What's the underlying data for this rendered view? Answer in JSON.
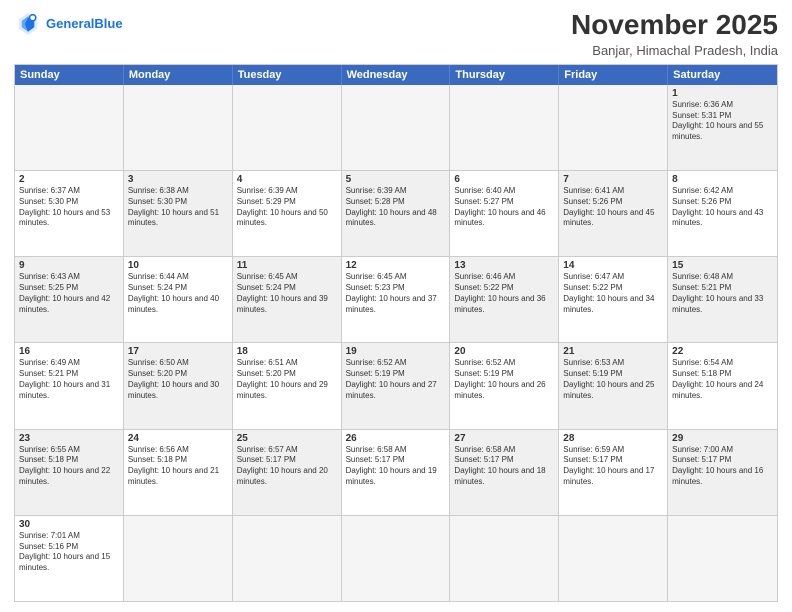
{
  "header": {
    "logo_general": "General",
    "logo_blue": "Blue",
    "title": "November 2025",
    "subtitle": "Banjar, Himachal Pradesh, India"
  },
  "weekdays": [
    "Sunday",
    "Monday",
    "Tuesday",
    "Wednesday",
    "Thursday",
    "Friday",
    "Saturday"
  ],
  "rows": [
    [
      {
        "day": "",
        "text": "",
        "empty": true
      },
      {
        "day": "",
        "text": "",
        "empty": true
      },
      {
        "day": "",
        "text": "",
        "empty": true
      },
      {
        "day": "",
        "text": "",
        "empty": true
      },
      {
        "day": "",
        "text": "",
        "empty": true
      },
      {
        "day": "",
        "text": "",
        "empty": true
      },
      {
        "day": "1",
        "text": "Sunrise: 6:36 AM\nSunset: 5:31 PM\nDaylight: 10 hours and 55 minutes.",
        "empty": false,
        "shaded": true
      }
    ],
    [
      {
        "day": "2",
        "text": "Sunrise: 6:37 AM\nSunset: 5:30 PM\nDaylight: 10 hours and 53 minutes.",
        "empty": false,
        "shaded": false
      },
      {
        "day": "3",
        "text": "Sunrise: 6:38 AM\nSunset: 5:30 PM\nDaylight: 10 hours and 51 minutes.",
        "empty": false,
        "shaded": true
      },
      {
        "day": "4",
        "text": "Sunrise: 6:39 AM\nSunset: 5:29 PM\nDaylight: 10 hours and 50 minutes.",
        "empty": false,
        "shaded": false
      },
      {
        "day": "5",
        "text": "Sunrise: 6:39 AM\nSunset: 5:28 PM\nDaylight: 10 hours and 48 minutes.",
        "empty": false,
        "shaded": true
      },
      {
        "day": "6",
        "text": "Sunrise: 6:40 AM\nSunset: 5:27 PM\nDaylight: 10 hours and 46 minutes.",
        "empty": false,
        "shaded": false
      },
      {
        "day": "7",
        "text": "Sunrise: 6:41 AM\nSunset: 5:26 PM\nDaylight: 10 hours and 45 minutes.",
        "empty": false,
        "shaded": true
      },
      {
        "day": "8",
        "text": "Sunrise: 6:42 AM\nSunset: 5:26 PM\nDaylight: 10 hours and 43 minutes.",
        "empty": false,
        "shaded": false
      }
    ],
    [
      {
        "day": "9",
        "text": "Sunrise: 6:43 AM\nSunset: 5:25 PM\nDaylight: 10 hours and 42 minutes.",
        "empty": false,
        "shaded": true
      },
      {
        "day": "10",
        "text": "Sunrise: 6:44 AM\nSunset: 5:24 PM\nDaylight: 10 hours and 40 minutes.",
        "empty": false,
        "shaded": false
      },
      {
        "day": "11",
        "text": "Sunrise: 6:45 AM\nSunset: 5:24 PM\nDaylight: 10 hours and 39 minutes.",
        "empty": false,
        "shaded": true
      },
      {
        "day": "12",
        "text": "Sunrise: 6:45 AM\nSunset: 5:23 PM\nDaylight: 10 hours and 37 minutes.",
        "empty": false,
        "shaded": false
      },
      {
        "day": "13",
        "text": "Sunrise: 6:46 AM\nSunset: 5:22 PM\nDaylight: 10 hours and 36 minutes.",
        "empty": false,
        "shaded": true
      },
      {
        "day": "14",
        "text": "Sunrise: 6:47 AM\nSunset: 5:22 PM\nDaylight: 10 hours and 34 minutes.",
        "empty": false,
        "shaded": false
      },
      {
        "day": "15",
        "text": "Sunrise: 6:48 AM\nSunset: 5:21 PM\nDaylight: 10 hours and 33 minutes.",
        "empty": false,
        "shaded": true
      }
    ],
    [
      {
        "day": "16",
        "text": "Sunrise: 6:49 AM\nSunset: 5:21 PM\nDaylight: 10 hours and 31 minutes.",
        "empty": false,
        "shaded": false
      },
      {
        "day": "17",
        "text": "Sunrise: 6:50 AM\nSunset: 5:20 PM\nDaylight: 10 hours and 30 minutes.",
        "empty": false,
        "shaded": true
      },
      {
        "day": "18",
        "text": "Sunrise: 6:51 AM\nSunset: 5:20 PM\nDaylight: 10 hours and 29 minutes.",
        "empty": false,
        "shaded": false
      },
      {
        "day": "19",
        "text": "Sunrise: 6:52 AM\nSunset: 5:19 PM\nDaylight: 10 hours and 27 minutes.",
        "empty": false,
        "shaded": true
      },
      {
        "day": "20",
        "text": "Sunrise: 6:52 AM\nSunset: 5:19 PM\nDaylight: 10 hours and 26 minutes.",
        "empty": false,
        "shaded": false
      },
      {
        "day": "21",
        "text": "Sunrise: 6:53 AM\nSunset: 5:19 PM\nDaylight: 10 hours and 25 minutes.",
        "empty": false,
        "shaded": true
      },
      {
        "day": "22",
        "text": "Sunrise: 6:54 AM\nSunset: 5:18 PM\nDaylight: 10 hours and 24 minutes.",
        "empty": false,
        "shaded": false
      }
    ],
    [
      {
        "day": "23",
        "text": "Sunrise: 6:55 AM\nSunset: 5:18 PM\nDaylight: 10 hours and 22 minutes.",
        "empty": false,
        "shaded": true
      },
      {
        "day": "24",
        "text": "Sunrise: 6:56 AM\nSunset: 5:18 PM\nDaylight: 10 hours and 21 minutes.",
        "empty": false,
        "shaded": false
      },
      {
        "day": "25",
        "text": "Sunrise: 6:57 AM\nSunset: 5:17 PM\nDaylight: 10 hours and 20 minutes.",
        "empty": false,
        "shaded": true
      },
      {
        "day": "26",
        "text": "Sunrise: 6:58 AM\nSunset: 5:17 PM\nDaylight: 10 hours and 19 minutes.",
        "empty": false,
        "shaded": false
      },
      {
        "day": "27",
        "text": "Sunrise: 6:58 AM\nSunset: 5:17 PM\nDaylight: 10 hours and 18 minutes.",
        "empty": false,
        "shaded": true
      },
      {
        "day": "28",
        "text": "Sunrise: 6:59 AM\nSunset: 5:17 PM\nDaylight: 10 hours and 17 minutes.",
        "empty": false,
        "shaded": false
      },
      {
        "day": "29",
        "text": "Sunrise: 7:00 AM\nSunset: 5:17 PM\nDaylight: 10 hours and 16 minutes.",
        "empty": false,
        "shaded": true
      }
    ],
    [
      {
        "day": "30",
        "text": "Sunrise: 7:01 AM\nSunset: 5:16 PM\nDaylight: 10 hours and 15 minutes.",
        "empty": false,
        "shaded": false
      },
      {
        "day": "",
        "text": "",
        "empty": true
      },
      {
        "day": "",
        "text": "",
        "empty": true
      },
      {
        "day": "",
        "text": "",
        "empty": true
      },
      {
        "day": "",
        "text": "",
        "empty": true
      },
      {
        "day": "",
        "text": "",
        "empty": true
      },
      {
        "day": "",
        "text": "",
        "empty": true
      }
    ]
  ]
}
